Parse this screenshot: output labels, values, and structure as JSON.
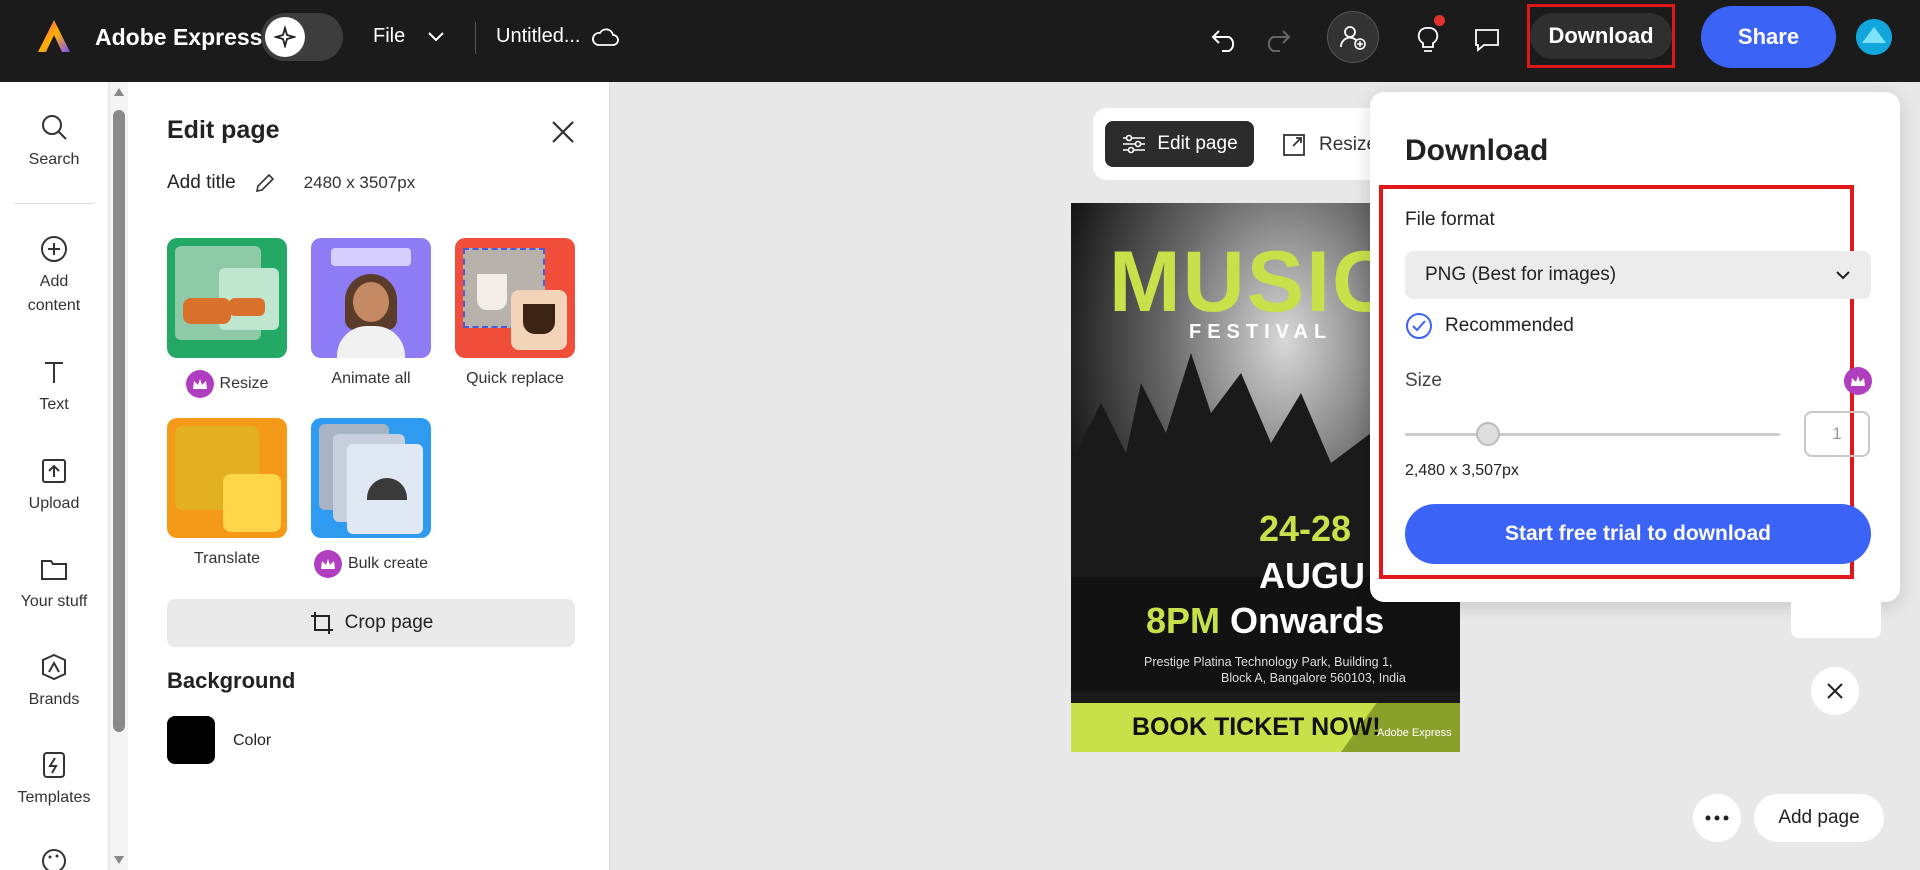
{
  "app": {
    "name": "Adobe Express"
  },
  "topbar": {
    "file_label": "File",
    "doc_title": "Untitled...",
    "download_label": "Download",
    "share_label": "Share"
  },
  "rail": {
    "items": [
      {
        "label": "Search",
        "icon": "search-icon"
      },
      {
        "label": "Add content",
        "icon": "plus-circle-icon"
      },
      {
        "label": "Text",
        "icon": "text-icon"
      },
      {
        "label": "Upload",
        "icon": "upload-icon"
      },
      {
        "label": "Your stuff",
        "icon": "folder-icon"
      },
      {
        "label": "Brands",
        "icon": "brands-icon"
      },
      {
        "label": "Templates",
        "icon": "templates-icon"
      }
    ]
  },
  "panel": {
    "title": "Edit page",
    "add_title": "Add title",
    "dimensions": "2480 x 3507px",
    "cards": [
      {
        "label": "Resize",
        "premium": true
      },
      {
        "label": "Animate all",
        "premium": false
      },
      {
        "label": "Quick replace",
        "premium": false
      },
      {
        "label": "Translate",
        "premium": false
      },
      {
        "label": "Bulk create",
        "premium": true
      }
    ],
    "crop_label": "Crop page",
    "background_title": "Background",
    "color_label": "Color"
  },
  "canvas": {
    "edit_page_label": "Edit page",
    "resize_label": "Resize",
    "add_page_label": "Add page",
    "poster": {
      "headline": "MUSIC",
      "sub": "FESTIVAL",
      "dates": "24-28",
      "month": "AUGU",
      "time_accent": "8PM",
      "time_rest": "Onwards",
      "address_line1": "Prestige Platina Technology Park, Building 1,",
      "address_line2": "Block A, Bangalore 560103, India",
      "cta": "BOOK TICKET NOW!",
      "watermark": "Adobe Express"
    }
  },
  "download_popover": {
    "title": "Download",
    "file_format_label": "File format",
    "file_format_value": "PNG (Best for images)",
    "recommended_label": "Recommended",
    "size_label": "Size",
    "size_value": "1",
    "size_dims": "2,480 x 3,507px",
    "trial_button": "Start free trial to download"
  },
  "colors": {
    "accent": "#3b63f5",
    "highlight": "#e0181b",
    "premium": "#b03fbf",
    "poster_green": "#c8e04a"
  }
}
